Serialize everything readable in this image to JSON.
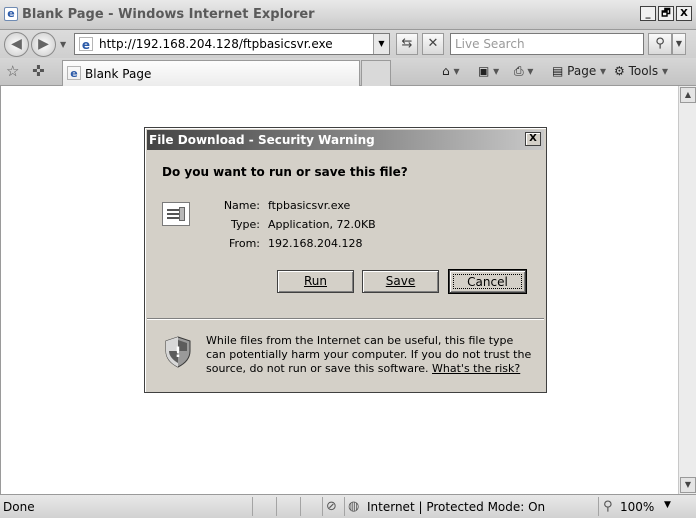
{
  "window": {
    "title": "Blank Page - Windows Internet Explorer",
    "minimize": "_",
    "maximize": "🗗",
    "close": "X"
  },
  "address_bar": {
    "url": "http://192.168.204.128/ftpbasicsvr.exe",
    "search_placeholder": "Live Search"
  },
  "tab": {
    "label": "Blank Page"
  },
  "command_bar": {
    "page_label": "Page",
    "tools_label": "Tools"
  },
  "status_bar": {
    "status": "Done",
    "zone": "Internet | Protected Mode: On",
    "zoom": "100%"
  },
  "dialog": {
    "title": "File Download - Security Warning",
    "question": "Do you want to run or save this file?",
    "name_label": "Name:",
    "name_value": "ftpbasicsvr.exe",
    "type_label": "Type:",
    "type_value": "Application, 72.0KB",
    "from_label": "From:",
    "from_value": "192.168.204.128",
    "run_button": "Run",
    "save_button": "Save",
    "cancel_button": "Cancel",
    "warning_text": "While files from the Internet can be useful, this file type can potentially harm your computer. If you do not trust the source, do not run or save this software.",
    "risk_link": "What's the risk?"
  }
}
